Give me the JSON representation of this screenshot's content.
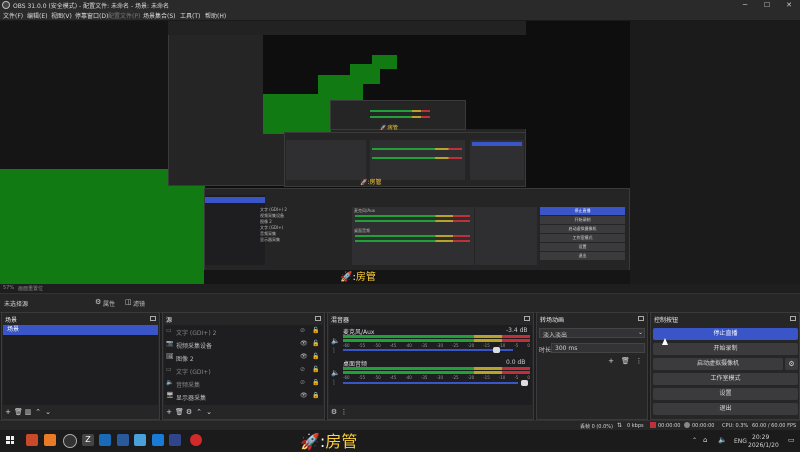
{
  "window": {
    "title": "OBS 31.0.0 (安全模式) - 配置文件: 未命名 - 场景: 未命名",
    "minimize": "─",
    "maximize": "☐",
    "close": "✕"
  },
  "menu": [
    {
      "label": "文件(F)",
      "enabled": true
    },
    {
      "label": "编辑(E)",
      "enabled": true
    },
    {
      "label": "视图(V)",
      "enabled": true
    },
    {
      "label": "停靠窗口(D)",
      "enabled": true
    },
    {
      "label": "配置文件(P)",
      "enabled": false
    },
    {
      "label": "场景集合(S)",
      "enabled": true
    },
    {
      "label": "工具(T)",
      "enabled": true
    },
    {
      "label": "帮助(H)",
      "enabled": true
    }
  ],
  "preview": {
    "overlay_label": "房管",
    "mini_rows": [
      {
        "label": "文字 (GDI+) 2"
      },
      {
        "label": "视频采集设备"
      },
      {
        "label": "图像 2"
      },
      {
        "label": "文字 (GDI+)"
      },
      {
        "label": "音频采集"
      },
      {
        "label": "显示器采集"
      }
    ],
    "mini_audio": [
      {
        "label": "麦克风/Aux"
      },
      {
        "label": "桌面音频"
      }
    ],
    "mini_controls": [
      {
        "label": "停止直播",
        "primary": true
      },
      {
        "label": "开始录制",
        "primary": false
      },
      {
        "label": "启动虚拟摄像机",
        "primary": false
      },
      {
        "label": "工作室模式",
        "primary": false
      },
      {
        "label": "设置",
        "primary": false
      },
      {
        "label": "退出",
        "primary": false
      }
    ]
  },
  "zoom_row": {
    "zoom": "57%",
    "mode": "画面重置位"
  },
  "source_bar": {
    "no_source": "未选择源",
    "properties": "属性",
    "filters": "滤镜"
  },
  "scenes": {
    "title": "场景",
    "items": [
      "场景"
    ],
    "selected": 0
  },
  "sources": {
    "title": "源",
    "items": [
      {
        "name": "文字 (GDI+) 2",
        "icon": "text-icon",
        "visible": false
      },
      {
        "name": "视频采集设备",
        "icon": "camera-icon",
        "visible": true
      },
      {
        "name": "图像 2",
        "icon": "image-icon",
        "visible": true
      },
      {
        "name": "文字 (GDI+)",
        "icon": "text-icon",
        "visible": false
      },
      {
        "name": "音频采集",
        "icon": "speaker-icon",
        "visible": false
      },
      {
        "name": "显示器采集",
        "icon": "monitor-icon",
        "visible": true
      }
    ]
  },
  "mixer": {
    "title": "混音器",
    "channels": [
      {
        "name": "麦克风/Aux",
        "db": "-3.4 dB",
        "level": 0.72,
        "volume": 0.96
      },
      {
        "name": "桌面音频",
        "db": "0.0 dB",
        "level": 0.55,
        "volume": 0.97
      }
    ],
    "scale": [
      "-60",
      "-55",
      "-50",
      "-45",
      "-40",
      "-35",
      "-30",
      "-25",
      "-20",
      "-15",
      "-10",
      "-5",
      "0"
    ]
  },
  "transitions": {
    "title": "转场动画",
    "selected": "淡入淡出",
    "duration_label": "时长",
    "duration_value": "300 ms"
  },
  "controls": {
    "title": "控制按钮",
    "buttons": [
      {
        "label": "停止直播",
        "primary": true
      },
      {
        "label": "开始录制",
        "primary": false
      },
      {
        "label": "启动虚拟摄像机",
        "primary": false
      },
      {
        "label": "工作室模式",
        "primary": false
      },
      {
        "label": "设置",
        "primary": false
      },
      {
        "label": "退出",
        "primary": false
      }
    ]
  },
  "status": {
    "dropped": "丢帧 0 (0.0%)",
    "bitrate": "0 kbps",
    "stream_time": "00:00:00",
    "rec_time": "00:00:00",
    "cpu": "CPU: 0.3%",
    "fps": "60.00 / 60.00 FPS"
  },
  "taskbar": {
    "overlay": "房管",
    "lang": "ENG",
    "time": "20:29",
    "date": "2026/1/20"
  }
}
